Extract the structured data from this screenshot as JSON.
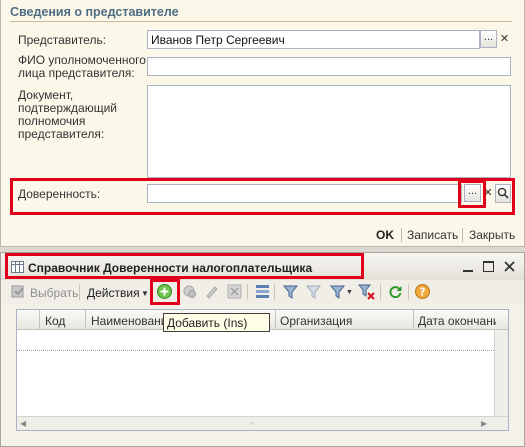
{
  "form": {
    "section_title": "Сведения о представителе",
    "representative_label": "Представитель:",
    "representative_value": "Иванов Петр Сергеевич",
    "fio_label_line1": "ФИО уполномоченного",
    "fio_label_line2": "лица представителя:",
    "fio_value": "",
    "doc_label_line1": "Документ,",
    "doc_label_line2": "подтверждающий",
    "doc_label_line3": "полномочия",
    "doc_label_line4": "представителя:",
    "doc_value": "",
    "poa_label": "Доверенность:",
    "poa_value": "",
    "select_button": "...",
    "footer": {
      "ok": "OK",
      "save": "Записать",
      "close": "Закрыть"
    }
  },
  "window": {
    "title": "Справочник Доверенности налогоплательщика",
    "toolbar": {
      "choose": "Выбрать",
      "actions": "Действия"
    },
    "columns": [
      "Код",
      "Наименование",
      "Добавить (Ins)",
      "Организация",
      "Дата окончани"
    ],
    "tooltip": "Добавить (Ins)"
  },
  "colors": {
    "highlight": "#e0001b",
    "section_title": "#4f6e83",
    "form_bg": "#fbf8ea"
  },
  "icons": [
    "dots-icon",
    "clear-x-icon",
    "search-icon",
    "table-icon",
    "minimize-icon",
    "maximize-icon",
    "close-icon",
    "add-plus-icon",
    "copy-icon",
    "edit-icon",
    "delete-icon",
    "hierarchy-icon",
    "filter-icon",
    "refresh-icon",
    "help-icon"
  ]
}
